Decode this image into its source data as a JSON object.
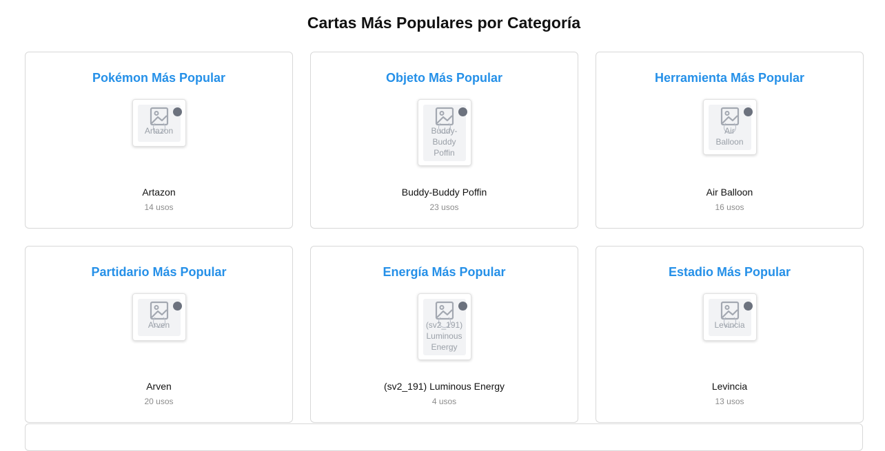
{
  "page": {
    "title": "Cartas Más Populares por Categoría"
  },
  "cards": [
    {
      "heading": "Pokémon Más Popular",
      "image_alt": "Artazon",
      "name": "Artazon",
      "uses": "14 usos"
    },
    {
      "heading": "Objeto Más Popular",
      "image_alt": "Buddy-Buddy Poffin",
      "name": "Buddy-Buddy Poffin",
      "uses": "23 usos"
    },
    {
      "heading": "Herramienta Más Popular",
      "image_alt": "Air Balloon",
      "name": "Air Balloon",
      "uses": "16 usos"
    },
    {
      "heading": "Partidario Más Popular",
      "image_alt": "Arven",
      "name": "Arven",
      "uses": "20 usos"
    },
    {
      "heading": "Energía Más Popular",
      "image_alt": "(sv2_191) Luminous Energy",
      "name": "(sv2_191) Luminous Energy",
      "uses": "4 usos"
    },
    {
      "heading": "Estadio Más Popular",
      "image_alt": "Levincia",
      "name": "Levincia",
      "uses": "13 usos"
    }
  ],
  "icons": {
    "image_placeholder": "image-placeholder-icon",
    "loading": "loading-spinner-icon",
    "status_dot": "status-dot-icon"
  },
  "colors": {
    "heading_accent": "#2590e8",
    "placeholder_bg": "#f2f3f5",
    "placeholder_text": "#9aa0a8",
    "status_dot": "#6c727e",
    "uses_text": "#8b8b8b"
  }
}
